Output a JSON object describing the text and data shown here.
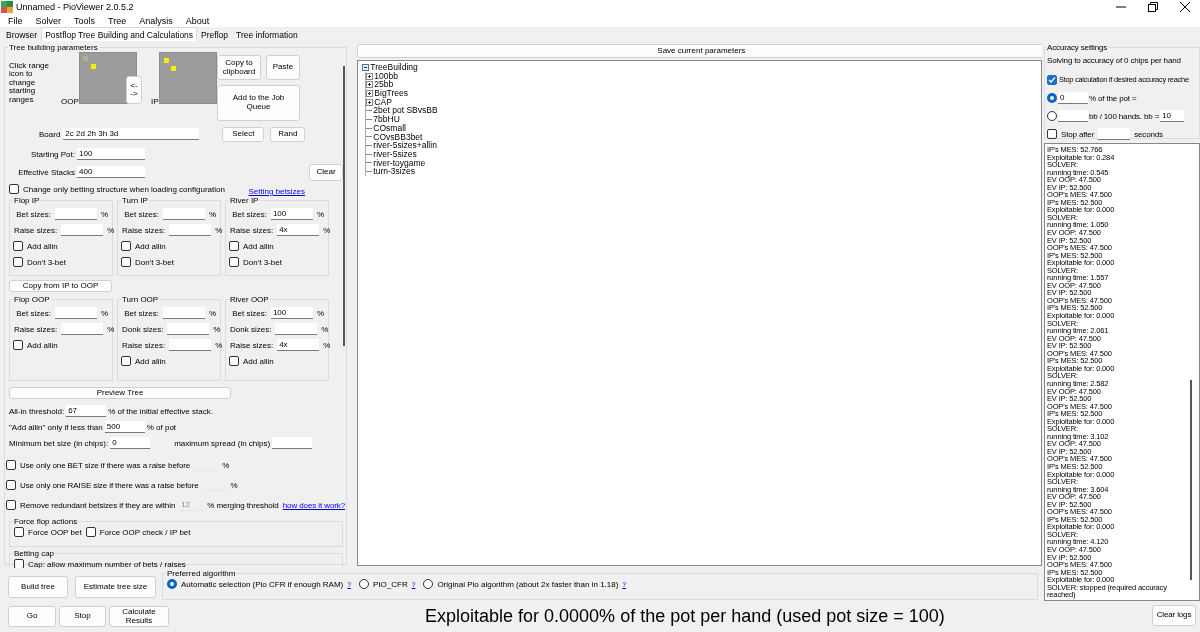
{
  "window": {
    "title": "Unnamed  - PioViewer 2.0.5.2"
  },
  "menu": [
    "File",
    "Solver",
    "Tools",
    "Tree",
    "Analysis",
    "About"
  ],
  "tabs": [
    {
      "label": "Browser",
      "selected": false
    },
    {
      "label": "Postflop Tree Building and Calculations",
      "selected": true
    },
    {
      "label": "Preflop",
      "selected": false
    },
    {
      "label": "Tree information",
      "selected": false
    }
  ],
  "tree_params": {
    "title": "Tree building parameters",
    "range_hint": "Click range icon to change starting ranges",
    "oop_label": "OOP",
    "ip_label": "IP",
    "swap_button": [
      "<-",
      "->"
    ],
    "copy_button": "Copy to clipboard",
    "paste_button": "Paste",
    "queue_button": "Add to the Job Queue",
    "select_button": "Select",
    "rand_button": "Rand",
    "board": {
      "label": "Board",
      "value": "2c 2d 2h 3h 3d"
    },
    "starting_pot": {
      "label": "Starting Pot:",
      "value": "100"
    },
    "effective_stacks": {
      "label": "Effective Stacks",
      "value": "400"
    },
    "clear_button": "Clear",
    "change_only": {
      "label": "Change only betting structure when loading configuration",
      "checked": false
    },
    "setting_link": "Setting betsizes",
    "ip_groups": [
      {
        "title": "Flop IP",
        "rows": [
          {
            "kind": "field",
            "label": "Bet sizes:",
            "unit": "%"
          },
          {
            "kind": "field",
            "label": "Raise sizes:",
            "unit": "%"
          },
          {
            "kind": "check",
            "label": "Add allin",
            "checked": false
          },
          {
            "kind": "check",
            "label": "Don't 3-bet",
            "checked": false
          }
        ]
      },
      {
        "title": "Turn IP",
        "rows": [
          {
            "kind": "field",
            "label": "Bet sizes:",
            "unit": "%"
          },
          {
            "kind": "field",
            "label": "Raise sizes:",
            "unit": "%"
          },
          {
            "kind": "check",
            "label": "Add allin",
            "checked": false
          },
          {
            "kind": "check",
            "label": "Don't 3-bet",
            "checked": false
          }
        ]
      },
      {
        "title": "River IP",
        "rows": [
          {
            "kind": "field",
            "label": "Bet sizes:",
            "value": "100",
            "unit": "%"
          },
          {
            "kind": "field",
            "label": "Raise sizes:",
            "value": "4x",
            "unit": "%"
          },
          {
            "kind": "check",
            "label": "Add allin",
            "checked": false
          },
          {
            "kind": "check",
            "label": "Don't 3-bet",
            "checked": false
          }
        ]
      }
    ],
    "copy_ip_button": "Copy from IP to OOP",
    "oop_groups": [
      {
        "title": "Flop OOP",
        "rows": [
          {
            "kind": "field",
            "label": "Bet sizes:",
            "unit": "%"
          },
          {
            "kind": "field",
            "label": "Raise sizes:",
            "unit": "%"
          },
          {
            "kind": "check",
            "label": "Add allin",
            "checked": false
          }
        ]
      },
      {
        "title": "Turn OOP",
        "rows": [
          {
            "kind": "field",
            "label": "Bet sizes:",
            "unit": "%"
          },
          {
            "kind": "field",
            "label": "Donk sizes:",
            "unit": "%"
          },
          {
            "kind": "field",
            "label": "Raise sizes:",
            "unit": "%"
          },
          {
            "kind": "check",
            "label": "Add allin",
            "checked": false
          }
        ]
      },
      {
        "title": "River OOP",
        "rows": [
          {
            "kind": "field",
            "label": "Bet sizes:",
            "value": "100",
            "unit": "%"
          },
          {
            "kind": "field",
            "label": "Donk sizes:",
            "unit": "%"
          },
          {
            "kind": "field",
            "label": "Raise sizes:",
            "value": "4x",
            "unit": "%"
          },
          {
            "kind": "check",
            "label": "Add allin",
            "checked": false
          }
        ]
      }
    ],
    "preview_button": "Preview Tree",
    "options": [
      {
        "kind": "input",
        "label": "All-in threshold:",
        "value": "67",
        "suffix": "% of the initial effective stack."
      },
      {
        "kind": "input",
        "label": "\"Add allin\" only if less than",
        "value": "500",
        "suffix": "% of pot"
      },
      {
        "kind": "pair",
        "label": "Minimum bet size (in chips):",
        "value": "0",
        "label2": "maximum spread (in chips)"
      },
      {
        "kind": "check",
        "label": "Use only one BET size if there was a raise before",
        "checked": false,
        "suffix": "%"
      },
      {
        "kind": "check",
        "label": "Use only one RAISE size if there was a raise before",
        "checked": false,
        "suffix": "%"
      },
      {
        "kind": "check",
        "label": "Remove redundant betsizes if they are within",
        "checked": false,
        "value": "12",
        "suffix": "% merging threshold",
        "link": "how does it work?"
      }
    ],
    "force_group": {
      "title": "Force flop actions",
      "items": [
        {
          "label": "Force OOP bet",
          "checked": false
        },
        {
          "label": "Force OOP check / IP bet",
          "checked": false
        }
      ]
    },
    "cap_group": {
      "title": "Betting cap",
      "items": [
        {
          "label": "Cap: allow maximum number of bets / raises",
          "checked": false
        }
      ]
    }
  },
  "tree": {
    "save_button": "Save current parameters",
    "items": [
      {
        "label": "TreeBuilding",
        "kind": "folder",
        "expanded": true,
        "children": [
          {
            "label": "100bb",
            "kind": "folder",
            "expanded": false
          },
          {
            "label": "25bb",
            "kind": "folder",
            "expanded": false
          },
          {
            "label": "BigTrees",
            "kind": "folder",
            "expanded": false
          },
          {
            "label": "CAP",
            "kind": "folder",
            "expanded": false
          },
          {
            "label": "2bet pot SBvsBB",
            "kind": "leaf"
          },
          {
            "label": "7bbHU",
            "kind": "leaf"
          },
          {
            "label": "COsmall",
            "kind": "leaf"
          },
          {
            "label": "COvsBB3bet",
            "kind": "leaf"
          },
          {
            "label": "river-5sizes+allin",
            "kind": "leaf"
          },
          {
            "label": "river-5sizes",
            "kind": "leaf"
          },
          {
            "label": "river-toygame",
            "kind": "leaf"
          },
          {
            "label": "turn-3sizes",
            "kind": "leaf"
          }
        ]
      }
    ]
  },
  "bottom": {
    "build_button": "Build tree",
    "estimate_button": "Estimate tree size",
    "go_button": "Go",
    "stop_button": "Stop",
    "calculate_button": "Calculate Results",
    "algorithm": {
      "title": "Preferred algorithm",
      "options": [
        {
          "label": "Automatic selection (Pio CFR if enough RAM)",
          "help": "?",
          "selected": true
        },
        {
          "label": "PIO_CFR",
          "help": "?",
          "selected": false
        },
        {
          "label": "Original Pio algorithm (about 2x faster than in 1.18)",
          "help": "?",
          "selected": false
        }
      ]
    },
    "status": "Exploitable for 0.0000% of the pot per hand (used pot size = 100)"
  },
  "accuracy": {
    "title": "Accuracy settings",
    "summary": "Solving to accuracy of 0 chips per hand",
    "stop_when_reached": {
      "label": "Stop calculation if desired accuracy reache",
      "checked": true
    },
    "modes": [
      {
        "selected": true,
        "value": "0",
        "suffix": "% of the pot ="
      },
      {
        "selected": false,
        "suffix": "bb / 100 hands. bb =",
        "extra_value": "10"
      }
    ],
    "stop_after": {
      "label": "Stop after",
      "checked": false,
      "suffix": "seconds"
    }
  },
  "log": [
    "IP's MES: 52.766",
    "Exploitable for: 0.284",
    "SOLVER:",
    "running time: 0.545",
    "EV OOP: 47.500",
    "EV IP: 52.500",
    "OOP's MES: 47.500",
    "IP's MES: 52.500",
    "Exploitable for: 0.000",
    "SOLVER:",
    "running time: 1.050",
    "EV OOP: 47.500",
    "EV IP: 52.500",
    "OOP's MES: 47.500",
    "IP's MES: 52.500",
    "Exploitable for: 0.000",
    "SOLVER:",
    "running time: 1.557",
    "EV OOP: 47.500",
    "EV IP: 52.500",
    "OOP's MES: 47.500",
    "IP's MES: 52.500",
    "Exploitable for: 0.000",
    "SOLVER:",
    "running time: 2.061",
    "EV OOP: 47.500",
    "EV IP: 52.500",
    "OOP's MES: 47.500",
    "IP's MES: 52.500",
    "Exploitable for: 0.000",
    "SOLVER:",
    "running time: 2.582",
    "EV OOP: 47.500",
    "EV IP: 52.500",
    "OOP's MES: 47.500",
    "IP's MES: 52.500",
    "Exploitable for: 0.000",
    "SOLVER:",
    "running time: 3.102",
    "EV OOP: 47.500",
    "EV IP: 52.500",
    "OOP's MES: 47.500",
    "IP's MES: 52.500",
    "Exploitable for: 0.000",
    "SOLVER:",
    "running time: 3.604",
    "EV OOP: 47.500",
    "EV IP: 52.500",
    "OOP's MES: 47.500",
    "IP's MES: 52.500",
    "Exploitable for: 0.000",
    "SOLVER:",
    "running time: 4.120",
    "EV OOP: 47.500",
    "EV IP: 52.500",
    "OOP's MES: 47.500",
    "IP's MES: 52.500",
    "Exploitable for: 0.000",
    "SOLVER: stopped (required accuracy reached)"
  ],
  "clear_logs_button": "Clear logs"
}
